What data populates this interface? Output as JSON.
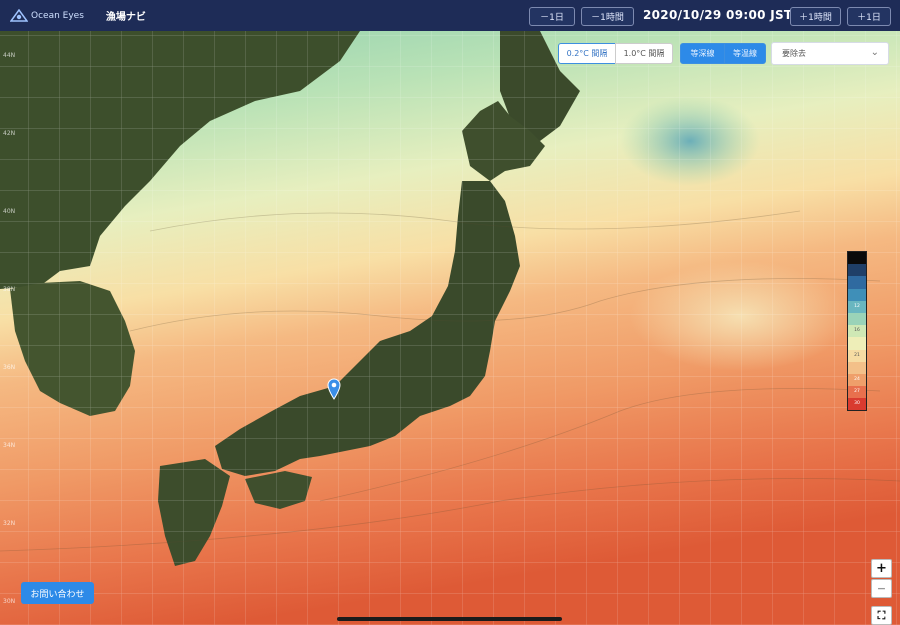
{
  "header": {
    "logo_text": "Ocean Eyes",
    "app_title": "漁場ナビ",
    "prev_day": "－1日",
    "prev_hour": "－1時間",
    "datetime": "2020/10/29 09:00 JST",
    "next_hour": "＋1時間",
    "next_day": "＋1日"
  },
  "map_controls": {
    "interval_fine": "0.2°C 間隔",
    "interval_coarse": "1.0°C 間隔",
    "isobath": "等深線",
    "isotherm": "等温線",
    "delete_dropdown": "要除去"
  },
  "legend": {
    "levels": [
      "",
      "",
      "",
      "",
      "12",
      "",
      "16",
      "",
      "21",
      "",
      "24",
      "27",
      "30"
    ],
    "colors": [
      "#0a0a0a",
      "#1f3f68",
      "#2f6aa0",
      "#3f8fb8",
      "#69b6c0",
      "#9ad3b8",
      "#cfe8b5",
      "#eeeeb8",
      "#f6dca3",
      "#f3c089",
      "#ef9f6a",
      "#e8704d",
      "#d93b2f"
    ]
  },
  "bottom": {
    "contact_button": "お問い合わせ",
    "zoom_in": "+",
    "zoom_out": "−",
    "fullscreen": "⛶"
  }
}
